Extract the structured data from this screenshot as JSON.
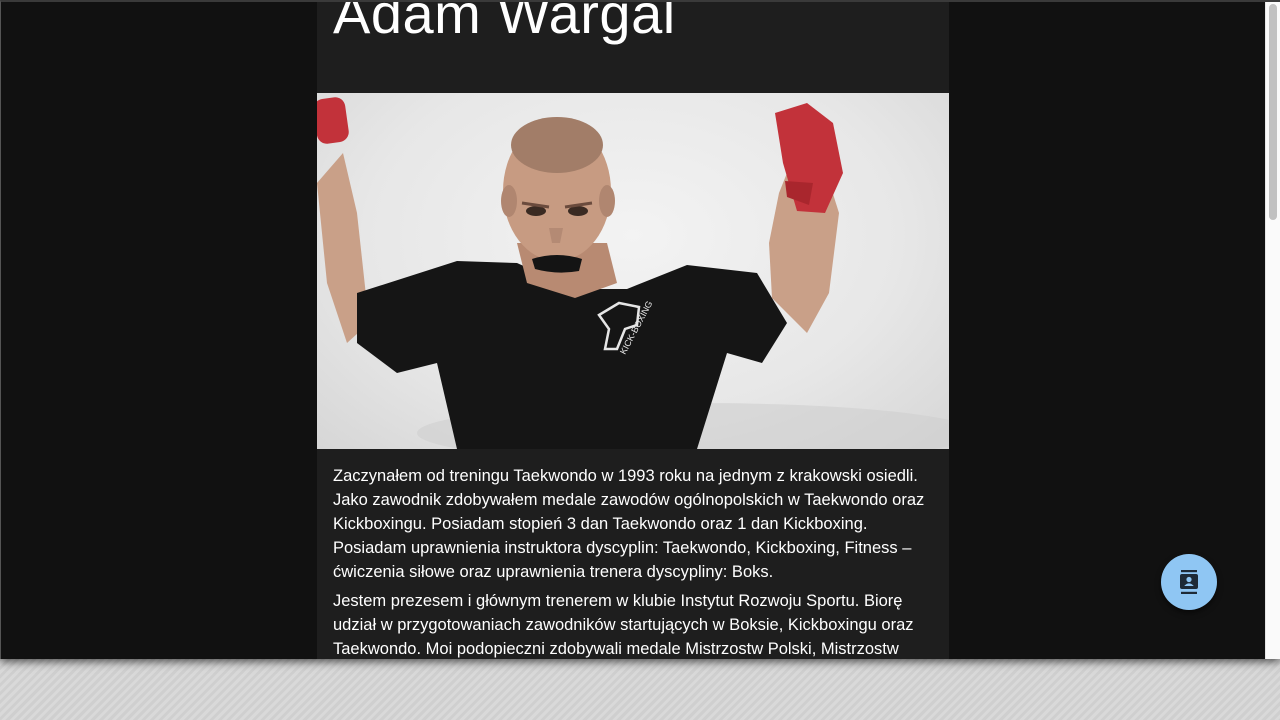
{
  "profile": {
    "name": "Adam Wargal",
    "photo": {
      "subject": "boxer-with-raised-fists",
      "shirt_print": "KICK-BOXING"
    },
    "bio": [
      "Zaczynałem od treningu Taekwondo w 1993 roku na jednym z krakowski osiedli. Jako zawodnik zdobywałem medale zawodów ogólnopolskich w Taekwondo oraz Kickboxingu. Posiadam stopień 3 dan Taekwondo oraz 1 dan Kickboxing. Posiadam uprawnienia instruktora dyscyplin: Taekwondo, Kickboxing, Fitness – ćwiczenia siłowe oraz uprawnienia trenera dyscypliny: Boks.",
      "Jestem prezesem i głównym trenerem w klubie Instytut Rozwoju Sportu. Biorę udział w przygotowaniach zawodników startujących w Boksie, Kickboxingu oraz Taekwondo. Moi podopieczni zdobywali medale Mistrzostw Polski, Mistrzostw"
    ]
  },
  "fab": {
    "icon": "contact-card-icon"
  },
  "colors": {
    "page_bg": "#111111",
    "card_bg": "#1e1e1e",
    "fab_bg": "#8fc6f3",
    "fab_icon": "#1e2a36"
  }
}
